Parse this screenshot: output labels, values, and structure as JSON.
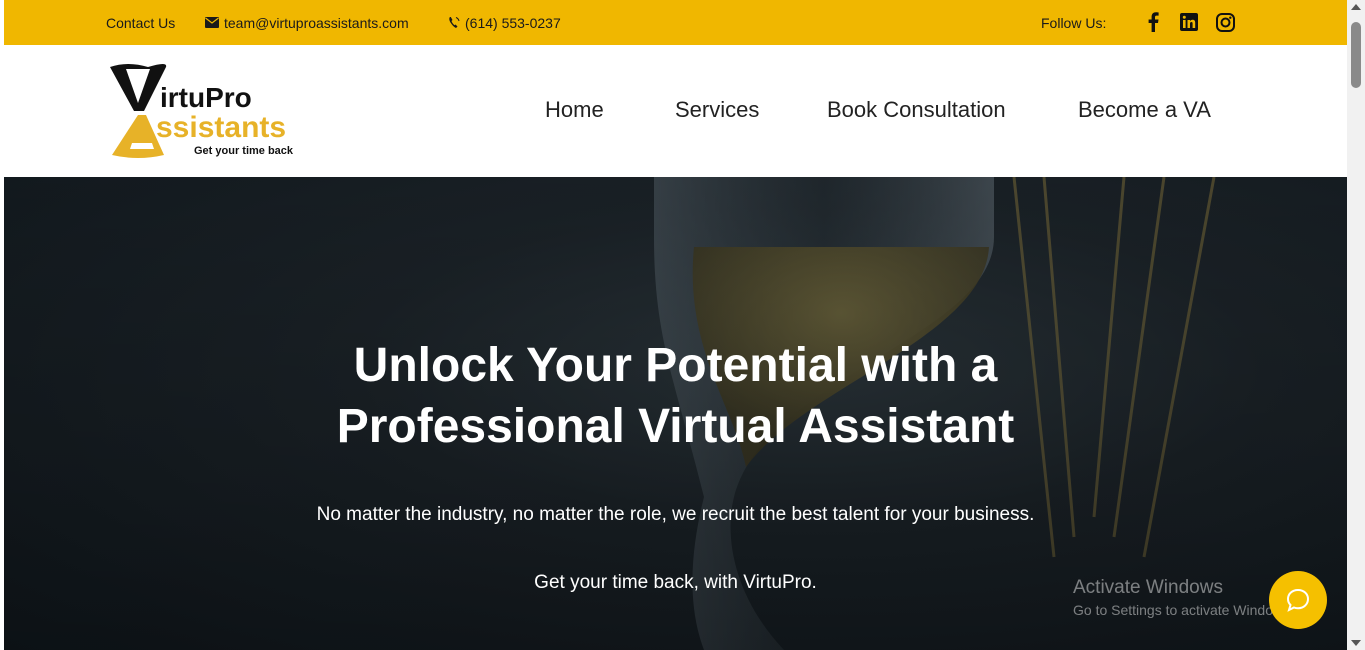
{
  "topbar": {
    "contact_label": "Contact Us",
    "email": "team@virtuproassistants.com",
    "phone": "(614) 553-0237",
    "follow_label": "Follow Us:",
    "social_icons": [
      "facebook-icon",
      "linkedin-icon",
      "instagram-icon"
    ],
    "bg_color": "#f0b700"
  },
  "logo": {
    "line1": "irtuPro",
    "line2": "ssistants",
    "tagline": "Get your time back",
    "accent_color": "#e7b228"
  },
  "nav": {
    "items": [
      {
        "label": "Home"
      },
      {
        "label": "Services"
      },
      {
        "label": "Book Consultation"
      },
      {
        "label": "Become a VA"
      }
    ]
  },
  "hero": {
    "title_line1": "Unlock Your Potential with a",
    "title_line2": "Professional Virtual Assistant",
    "subtitle": "No matter the industry, no matter the role, we recruit the best talent for your business.",
    "subtitle2": "Get your time back, with VirtuPro."
  },
  "watermark": {
    "line1": "Activate Windows",
    "line2": "Go to Settings to activate Windows."
  }
}
